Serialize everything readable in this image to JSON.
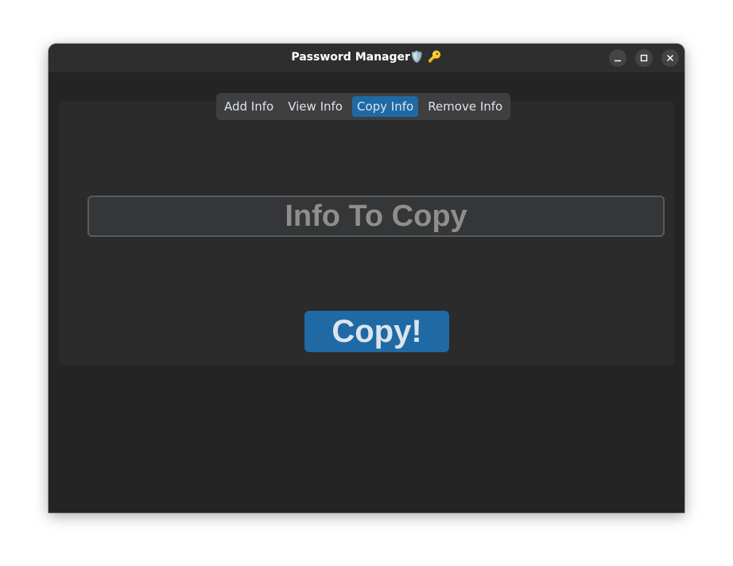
{
  "window": {
    "title": "Password Manager🛡️ 🔑",
    "controls": {
      "minimize_icon": "minimize-icon",
      "maximize_icon": "maximize-icon",
      "close_icon": "close-icon"
    }
  },
  "tabs": {
    "items": [
      {
        "label": "Add Info",
        "active": false
      },
      {
        "label": "View Info",
        "active": false
      },
      {
        "label": "Copy Info",
        "active": true
      },
      {
        "label": "Remove Info",
        "active": false
      }
    ]
  },
  "copy_form": {
    "entry_placeholder": "Info To Copy",
    "entry_value": "",
    "button_label": "Copy!"
  },
  "colors": {
    "accent": "#1f6aa5",
    "window_bg": "#242424",
    "frame_bg": "#2b2b2b",
    "titlebar_bg": "#2e2e2e",
    "text": "#dce4ee",
    "placeholder": "#8e8e8e"
  }
}
